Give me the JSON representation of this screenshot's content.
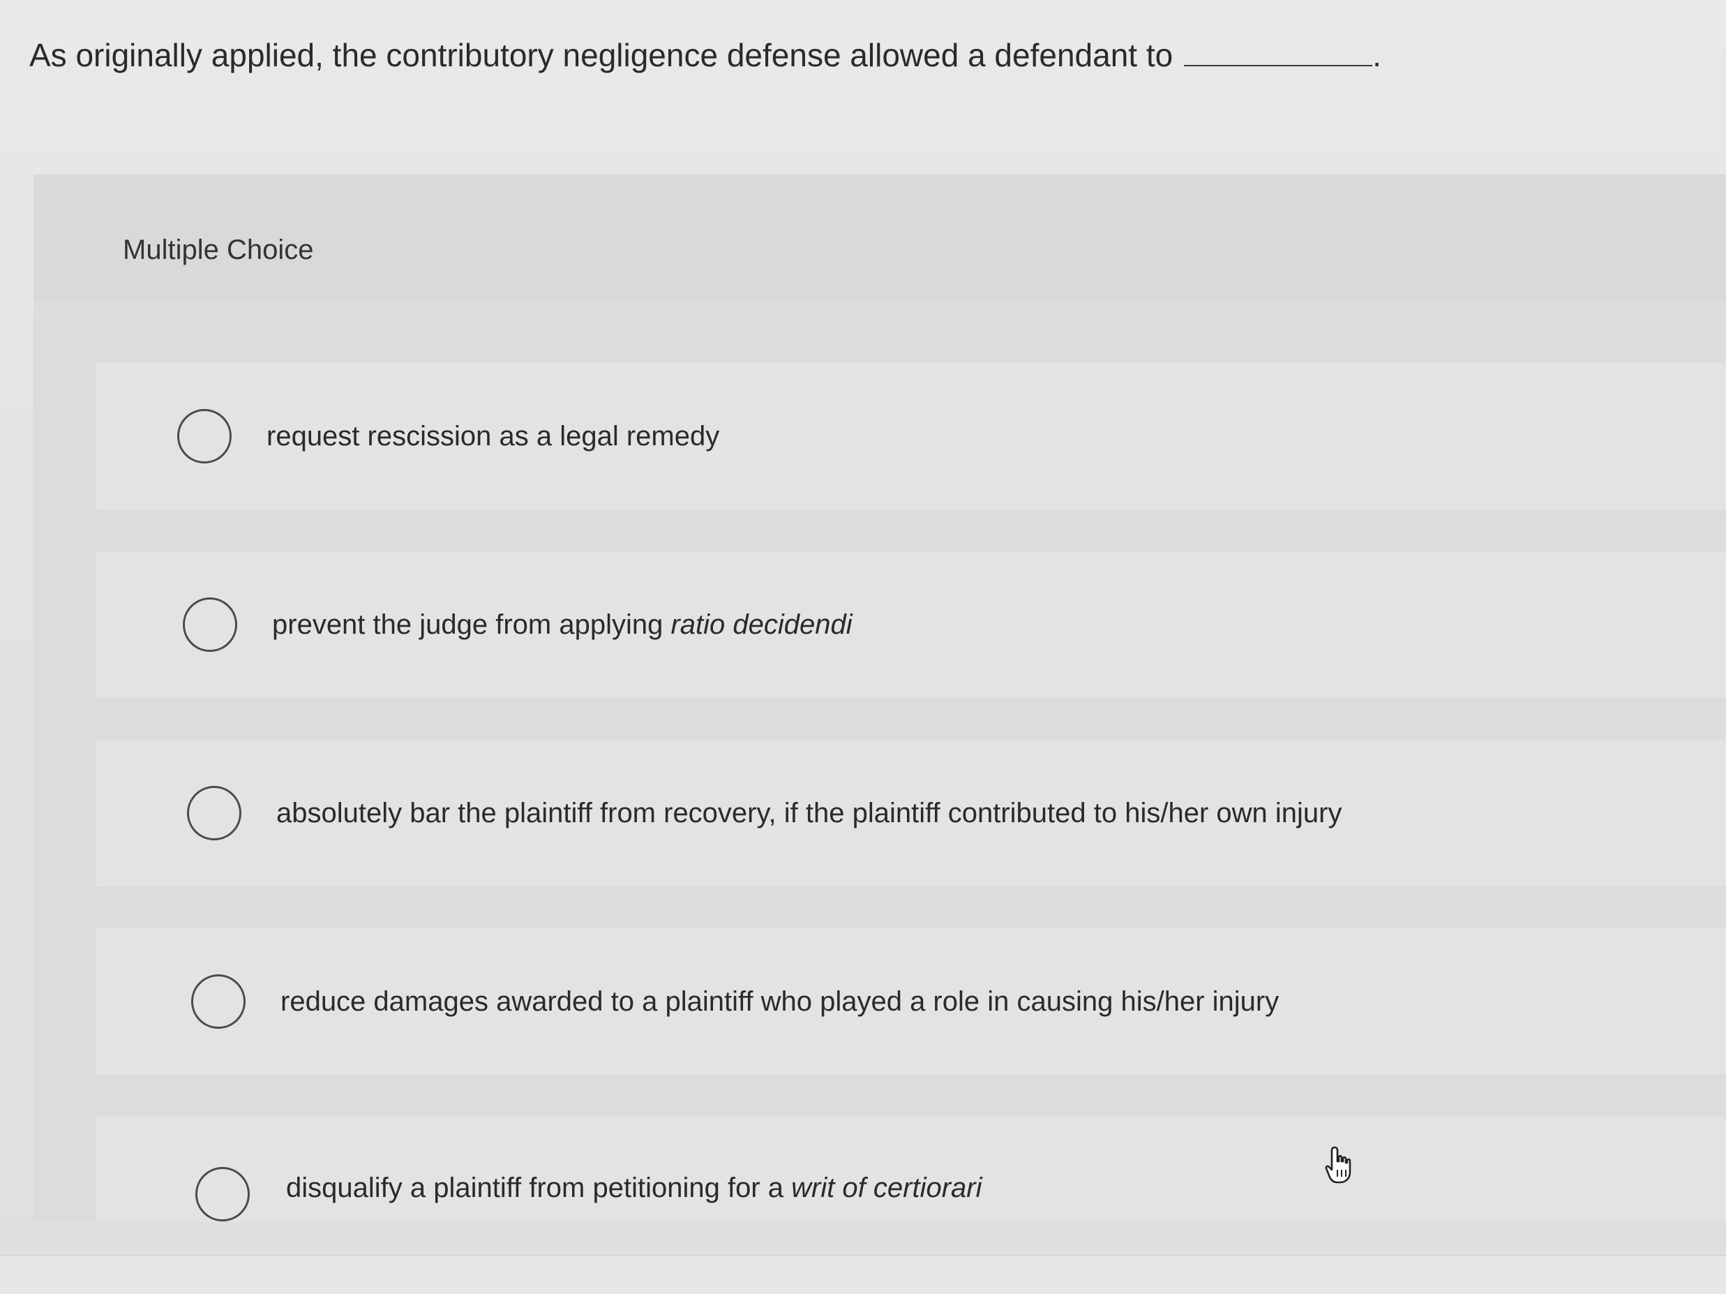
{
  "question": {
    "text": "As originally applied, the contributory negligence defense allowed a defendant to",
    "blank_suffix": "."
  },
  "panel": {
    "title": "Multiple Choice"
  },
  "options": [
    {
      "text": "request rescission as a legal remedy",
      "italic": ""
    },
    {
      "text": "prevent the judge from applying ",
      "italic": "ratio decidendi"
    },
    {
      "text": "absolutely bar the plaintiff from recovery, if the plaintiff contributed to his/her own injury",
      "italic": ""
    },
    {
      "text": "reduce damages awarded to a plaintiff who played a role in causing his/her injury",
      "italic": ""
    },
    {
      "text": "disqualify a plaintiff from petitioning for a ",
      "italic": "writ of certiorari"
    }
  ],
  "icons": {
    "radio": "radio-button-icon",
    "cursor": "hand-pointer-icon"
  },
  "colors": {
    "background": "#e6e7e5",
    "panel": "#dcdddb",
    "text": "#2a2a2a"
  }
}
